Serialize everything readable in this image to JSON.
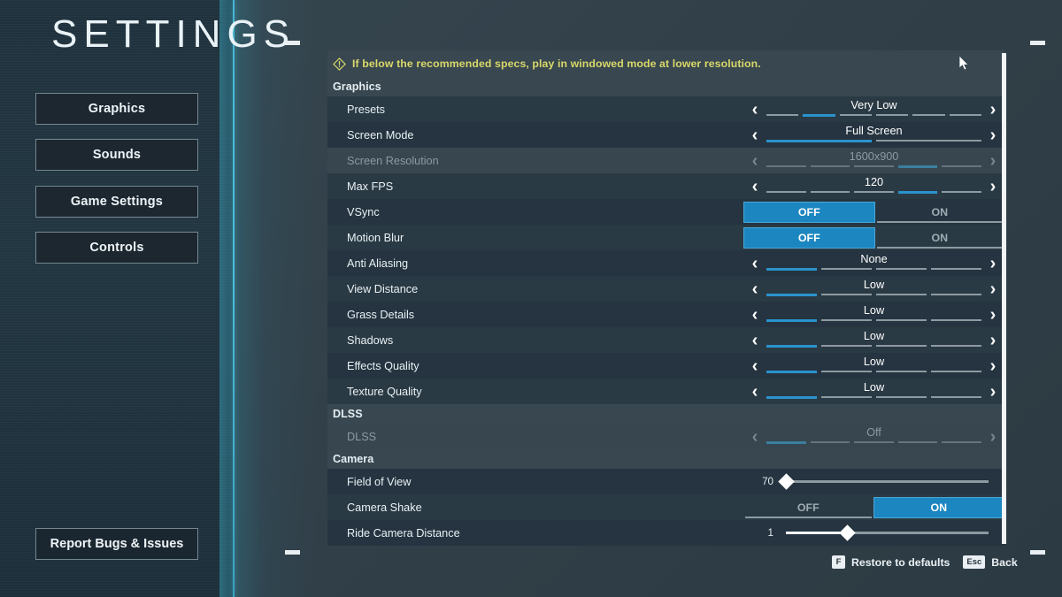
{
  "app": {
    "title": "SETTINGS",
    "accent_blue": "#1c86c0",
    "accent_seg_blue": "#2a93cd",
    "warning_yellow": "#d9d86a",
    "divider_cyan": "#49c0da"
  },
  "sidebar": {
    "items": [
      {
        "label": "Graphics",
        "name": "graphics"
      },
      {
        "label": "Sounds",
        "name": "sounds"
      },
      {
        "label": "Game Settings",
        "name": "game-settings"
      },
      {
        "label": "Controls",
        "name": "controls"
      }
    ],
    "report_button": "Report Bugs & Issues"
  },
  "warning": {
    "icon": "warning-diamond-icon",
    "text": "If below the recommended specs, play in windowed mode at lower resolution."
  },
  "sections": [
    {
      "header": "Graphics",
      "rows": [
        {
          "label": "Presets",
          "type": "stepper",
          "value": "Very Low",
          "segments": 6,
          "active_segment": 2,
          "disabled": false
        },
        {
          "label": "Screen Mode",
          "type": "stepper",
          "value": "Full Screen",
          "segments": 2,
          "active_segment": 1,
          "disabled": false
        },
        {
          "label": "Screen Resolution",
          "type": "stepper",
          "value": "1600x900",
          "segments": 5,
          "active_segment": 4,
          "disabled": true
        },
        {
          "label": "Max FPS",
          "type": "stepper",
          "value": "120",
          "segments": 5,
          "active_segment": 4,
          "disabled": false
        },
        {
          "label": "VSync",
          "type": "toggle",
          "options": [
            "OFF",
            "ON"
          ],
          "selected": 0,
          "disabled": false
        },
        {
          "label": "Motion Blur",
          "type": "toggle",
          "options": [
            "OFF",
            "ON"
          ],
          "selected": 0,
          "disabled": false
        },
        {
          "label": "Anti Aliasing",
          "type": "stepper",
          "value": "None",
          "segments": 4,
          "active_segment": 1,
          "disabled": false
        },
        {
          "label": "View Distance",
          "type": "stepper",
          "value": "Low",
          "segments": 4,
          "active_segment": 1,
          "disabled": false
        },
        {
          "label": "Grass Details",
          "type": "stepper",
          "value": "Low",
          "segments": 4,
          "active_segment": 1,
          "disabled": false
        },
        {
          "label": "Shadows",
          "type": "stepper",
          "value": "Low",
          "segments": 4,
          "active_segment": 1,
          "disabled": false
        },
        {
          "label": "Effects Quality",
          "type": "stepper",
          "value": "Low",
          "segments": 4,
          "active_segment": 1,
          "disabled": false
        },
        {
          "label": "Texture Quality",
          "type": "stepper",
          "value": "Low",
          "segments": 4,
          "active_segment": 1,
          "disabled": false
        }
      ]
    },
    {
      "header": "DLSS",
      "rows": [
        {
          "label": "DLSS",
          "type": "stepper",
          "value": "Off",
          "segments": 5,
          "active_segment": 1,
          "disabled": true
        }
      ]
    },
    {
      "header": "Camera",
      "rows": [
        {
          "label": "Field of View",
          "type": "slider",
          "value": "70",
          "fill_percent": 0,
          "handle_percent": 0,
          "disabled": false
        },
        {
          "label": "Camera Shake",
          "type": "toggle",
          "options": [
            "OFF",
            "ON"
          ],
          "selected": 1,
          "disabled": false
        },
        {
          "label": "Ride Camera Distance",
          "type": "slider",
          "value": "1",
          "fill_percent": 30,
          "handle_percent": 30,
          "disabled": false
        }
      ]
    }
  ],
  "footer": {
    "hints": [
      {
        "key": "F",
        "label": "Restore to defaults"
      },
      {
        "key": "Esc",
        "label": "Back"
      }
    ]
  },
  "chevrons": {
    "left": "‹",
    "right": "›"
  }
}
